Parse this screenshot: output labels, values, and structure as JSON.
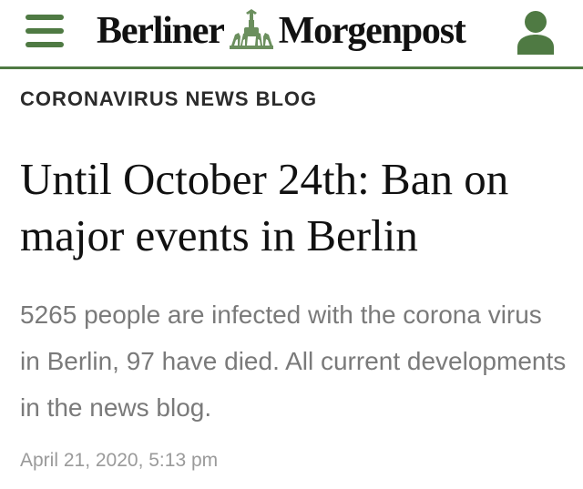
{
  "header": {
    "menu_icon": "hamburger-menu-icon",
    "logo": {
      "left_word": "Berliner",
      "right_word": "Morgenpost",
      "emblem_icon": "quadriga-emblem-icon"
    },
    "user_icon": "user-account-icon",
    "accent_color": "#4f7a43"
  },
  "article": {
    "category": "CORONAVIRUS NEWS BLOG",
    "headline": "Until October 24th: Ban on major events in Berlin",
    "teaser": "5265 people are infected with the corona virus in Berlin, 97 have died. All current developments in the news blog.",
    "date": "April 21, 2020, 5:13 pm"
  }
}
